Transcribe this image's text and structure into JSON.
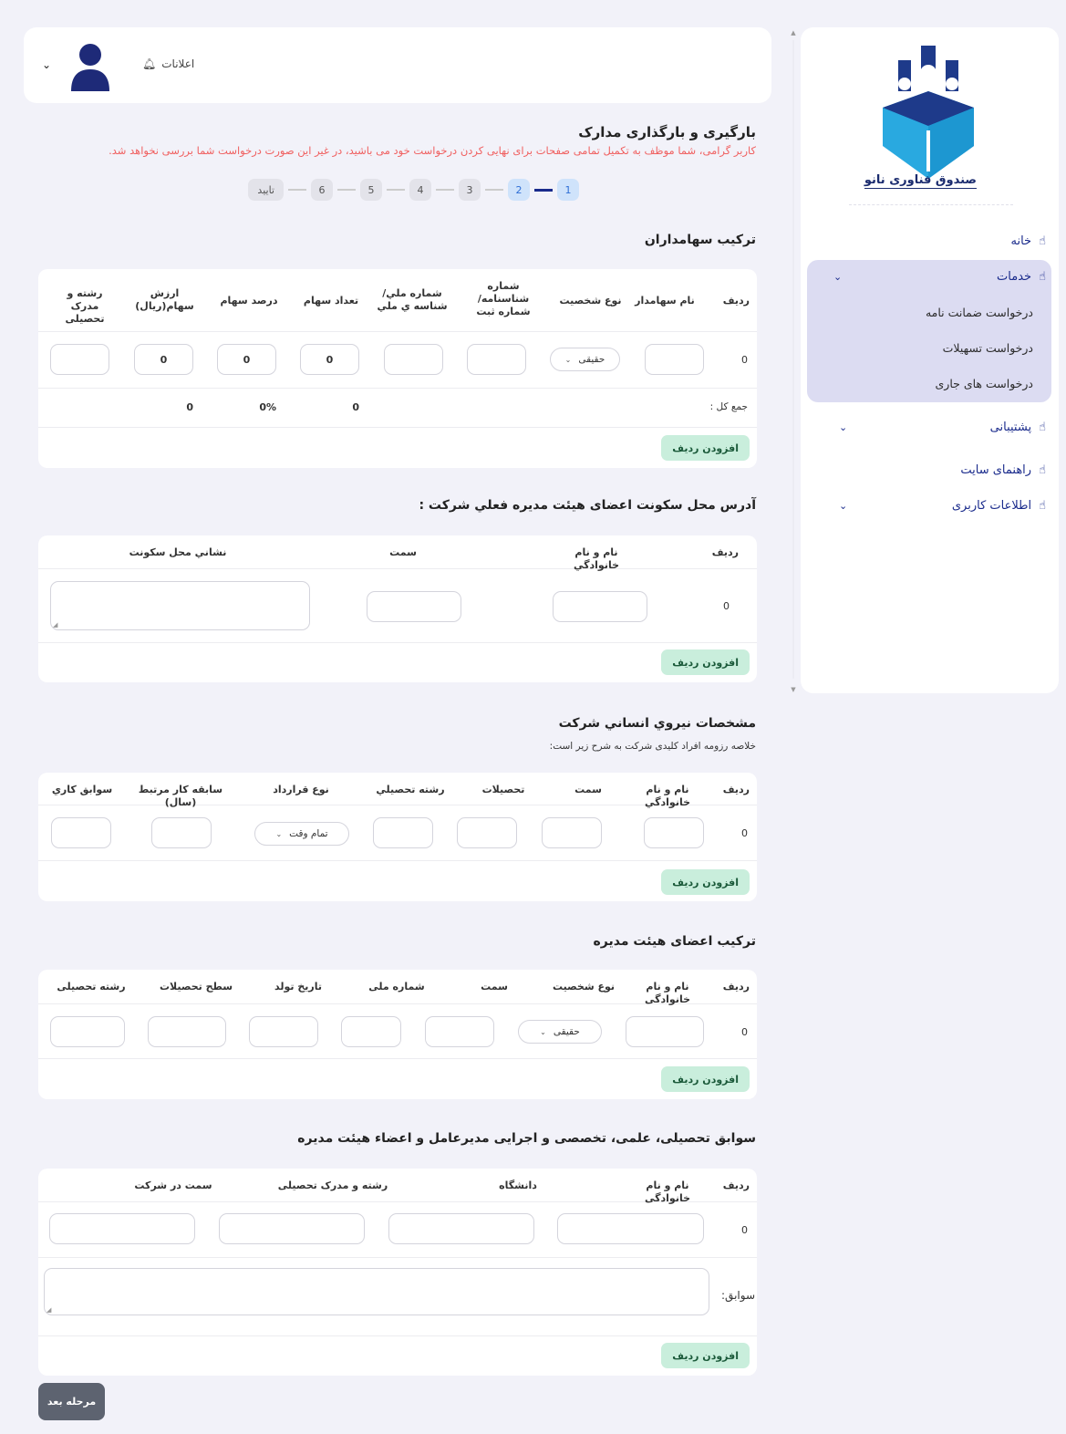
{
  "sidebar": {
    "logo_text": "صندوق فناوری نانو",
    "items": [
      {
        "label": "خانه"
      },
      {
        "label": "خدمات"
      },
      {
        "label": "پشتیبانی"
      },
      {
        "label": "راهنمای سایت"
      },
      {
        "label": "اطلاعات کاربری"
      }
    ],
    "sub_items": [
      "درخواست ضمانت نامه",
      "درخواست تسهیلات",
      "درخواست های جاری"
    ]
  },
  "header": {
    "notifications_label": "اعلانات"
  },
  "page": {
    "title": "بارگیری و بارگذاری مدارک",
    "warning": "کاربر گرامی، شما موظف به تکمیل تمامی صفحات برای نهایی کردن درخواست خود می باشید، در غیر این صورت درخواست شما بررسی نخواهد شد."
  },
  "stepper": [
    "1",
    "2",
    "3",
    "4",
    "5",
    "6",
    "تایید"
  ],
  "shareholders": {
    "title": "ترکیب سهامداران",
    "headers": [
      "ردیف",
      "نام سهامدار",
      "نوع شخصیت",
      "شماره شناسنامه/ شماره ثبت",
      "شماره ملي/ شناسه ي ملي",
      "تعداد سهام",
      "درصد سهام",
      "ارزش سهام(ريال)",
      "رشته و مدرک تحصیلی"
    ],
    "row_number": "0",
    "person_type": "حقیقی",
    "share_count": "0",
    "share_percent": "0",
    "share_value": "0",
    "sum_label": "جمع کل :",
    "sum_count": "0",
    "sum_percent": "0%",
    "sum_value": "0",
    "add_row": "افزودن ردیف"
  },
  "board_address": {
    "title": "آدرس محل سکونت اعضای هیئت مدیره فعلي شرکت :",
    "headers": [
      "رديف",
      "نام و نام خانوادگي",
      "سمت",
      "نشاني محل سكونت"
    ],
    "row_number": "0",
    "add_row": "افزودن ردیف"
  },
  "workforce": {
    "title": "مشخصات نيروي انساني شركت",
    "subtitle": "خلاصه رزومه افراد کلیدی شرکت به شرح زیر است:",
    "headers": [
      "رديف",
      "نام و نام خانوادگي",
      "سمت",
      "تحصيلات",
      "رشته تحصيلي",
      "نوع قرارداد",
      "سابقه کار مرتبط (سال)",
      "سوابق كاري"
    ],
    "row_number": "0",
    "contract_type": "تمام وقت",
    "add_row": "افزودن ردیف"
  },
  "board_members": {
    "title": "ترکیب اعضای هیئت مدیره",
    "headers": [
      "ردیف",
      "نام و نام خانوادگی",
      "نوع شخصیت",
      "سمت",
      "شماره ملی",
      "تاریخ تولد",
      "سطح تحصیلات",
      "رشته تحصیلی"
    ],
    "row_number": "0",
    "person_type": "حقیقی",
    "add_row": "افزودن ردیف"
  },
  "backgrounds": {
    "title": "سوابق تحصیلی، علمی، تخصصی و اجرایی مدیرعامل و اعضاء هیئت مدیره",
    "headers": [
      "ردیف",
      "نام و نام خانوادگی",
      "دانشگاه",
      "رشته و مدرک تحصیلی",
      "سمت در شرکت"
    ],
    "row_number": "0",
    "records_label": "سوابق:",
    "add_row": "افزودن ردیف"
  },
  "next_button": "مرحله بعد"
}
